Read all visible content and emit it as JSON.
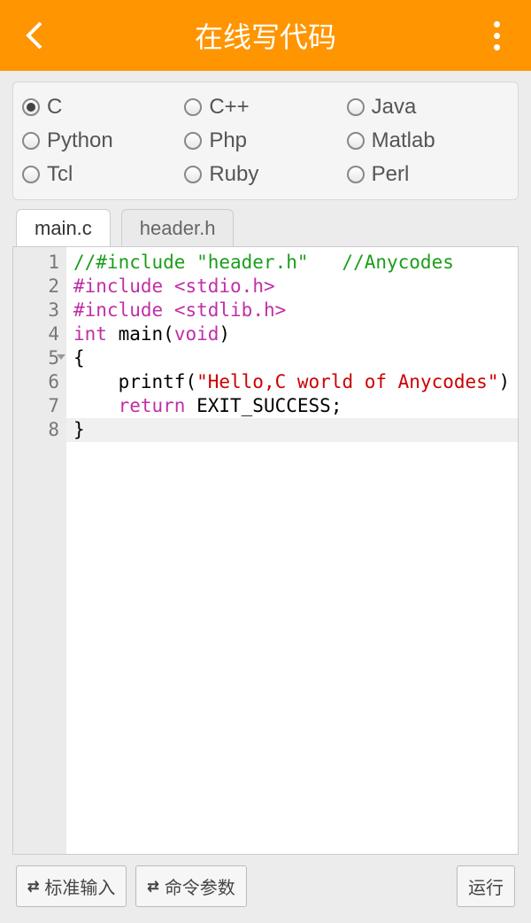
{
  "header": {
    "title": "在线写代码"
  },
  "languages": {
    "rows": [
      [
        {
          "label": "C",
          "selected": true
        },
        {
          "label": "C++",
          "selected": false
        },
        {
          "label": "Java",
          "selected": false
        }
      ],
      [
        {
          "label": "Python",
          "selected": false
        },
        {
          "label": "Php",
          "selected": false
        },
        {
          "label": "Matlab",
          "selected": false
        }
      ],
      [
        {
          "label": "Tcl",
          "selected": false
        },
        {
          "label": "Ruby",
          "selected": false
        },
        {
          "label": "Perl",
          "selected": false
        }
      ]
    ]
  },
  "tabs": [
    {
      "label": "main.c",
      "active": true
    },
    {
      "label": "header.h",
      "active": false
    }
  ],
  "code": {
    "line_numbers": [
      "1",
      "2",
      "3",
      "4",
      "5",
      "6",
      "7",
      "8"
    ],
    "fold_line_index": 4,
    "highlight_line_index": 7,
    "lines": [
      [
        {
          "cls": "tk-comment",
          "t": "//#include \"header.h\"   //Anycodes"
        }
      ],
      [
        {
          "cls": "tk-macro",
          "t": "#include"
        },
        {
          "cls": "tk-plain",
          "t": " "
        },
        {
          "cls": "tk-string-inc",
          "t": "<stdio.h>"
        }
      ],
      [
        {
          "cls": "tk-macro",
          "t": "#include"
        },
        {
          "cls": "tk-plain",
          "t": " "
        },
        {
          "cls": "tk-string-inc",
          "t": "<stdlib.h>"
        }
      ],
      [
        {
          "cls": "tk-type",
          "t": "int"
        },
        {
          "cls": "tk-plain",
          "t": " "
        },
        {
          "cls": "tk-func",
          "t": "main"
        },
        {
          "cls": "tk-paren",
          "t": "("
        },
        {
          "cls": "tk-type",
          "t": "void"
        },
        {
          "cls": "tk-paren",
          "t": ")"
        }
      ],
      [
        {
          "cls": "tk-paren",
          "t": "{"
        }
      ],
      [
        {
          "cls": "tk-plain",
          "t": "    "
        },
        {
          "cls": "tk-func",
          "t": "printf"
        },
        {
          "cls": "tk-paren",
          "t": "("
        },
        {
          "cls": "tk-string",
          "t": "\"Hello,C world of Anycodes\""
        },
        {
          "cls": "tk-paren",
          "t": ")"
        }
      ],
      [
        {
          "cls": "tk-plain",
          "t": "    "
        },
        {
          "cls": "tk-kw",
          "t": "return"
        },
        {
          "cls": "tk-plain",
          "t": " "
        },
        {
          "cls": "tk-ident",
          "t": "EXIT_SUCCESS"
        },
        {
          "cls": "tk-plain",
          "t": ";"
        }
      ],
      [
        {
          "cls": "tk-paren",
          "t": "}"
        }
      ]
    ]
  },
  "footer": {
    "stdin_label": "标准输入",
    "args_label": "命令参数",
    "run_label": "运行"
  }
}
